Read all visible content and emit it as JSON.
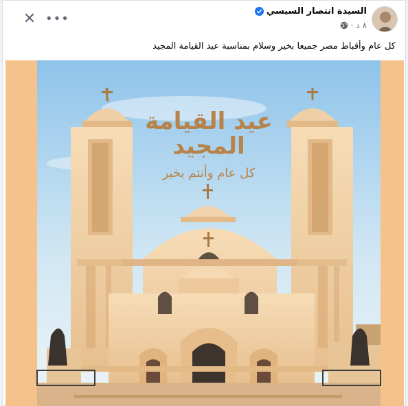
{
  "post": {
    "author_name": "السيدة انتصار السيسي",
    "timestamp": "٨ د",
    "text": "كل عام وأقباط مصر جميعا بخير وسلام بمناسبة عيد القيامة المجيد",
    "verified_color": "#1877f2"
  },
  "actions": {
    "close_icon_glyph": "✕",
    "more_icon_glyph": "•••"
  },
  "image": {
    "title_line1": "عيد القيامة",
    "title_line2": "المجيد",
    "subtitle": "كل عام وأنتم بخير",
    "text_color": "#b7834a",
    "sky_color": "#a9d2ee",
    "building_color": "#f3d4ac",
    "frame_color": "#f5c28c"
  }
}
